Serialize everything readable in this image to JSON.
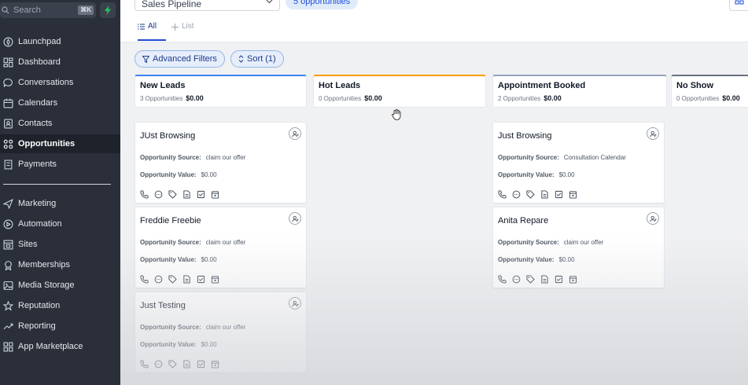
{
  "sidebar": {
    "search_label": "Search",
    "search_shortcut": "⌘K",
    "active_color": "#1e222b",
    "items": [
      {
        "label": "Launchpad",
        "icon": "rocket-icon"
      },
      {
        "label": "Dashboard",
        "icon": "dashboard-icon"
      },
      {
        "label": "Conversations",
        "icon": "chat-icon"
      },
      {
        "label": "Calendars",
        "icon": "calendar-icon"
      },
      {
        "label": "Contacts",
        "icon": "contacts-icon"
      },
      {
        "label": "Opportunities",
        "icon": "opportunities-icon",
        "active": true
      },
      {
        "label": "Payments",
        "icon": "payments-icon"
      },
      {
        "label": "Marketing",
        "icon": "send-icon"
      },
      {
        "label": "Automation",
        "icon": "automation-icon"
      },
      {
        "label": "Sites",
        "icon": "sites-icon"
      },
      {
        "label": "Memberships",
        "icon": "memberships-icon"
      },
      {
        "label": "Media Storage",
        "icon": "media-icon"
      },
      {
        "label": "Reputation",
        "icon": "star-icon"
      },
      {
        "label": "Reporting",
        "icon": "trend-icon"
      },
      {
        "label": "App Marketplace",
        "icon": "apps-icon"
      }
    ]
  },
  "header": {
    "pipeline": "Sales Pipeline",
    "opportunities_count": "5 opportunities",
    "tabs": [
      {
        "label": "All",
        "active": true
      },
      {
        "label": "List",
        "active": false
      }
    ],
    "filters": {
      "advanced": "Advanced Filters",
      "sort": "Sort (1)"
    }
  },
  "columns": [
    {
      "name": "New Leads",
      "count": "3 Opportunities",
      "value": "$0.00",
      "color": "#3b82f6"
    },
    {
      "name": "Hot Leads",
      "count": "0 Opportunities",
      "value": "$0.00",
      "color": "#f59e0b"
    },
    {
      "name": "Appointment Booked",
      "count": "2 Opportunities",
      "value": "$0.00",
      "color": "#94a3b8"
    },
    {
      "name": "No Show",
      "count": "0 Opportunities",
      "value": "$0.00",
      "color": "#6b7280"
    }
  ],
  "cards": [
    {
      "column": 0,
      "title": "JUst Browsing",
      "source_label": "Opportunity Source:",
      "source": "claim our offer",
      "value_label": "Opportunity Value:",
      "value": "$0.00"
    },
    {
      "column": 0,
      "title": "Freddie Freebie",
      "source_label": "Opportunity Source:",
      "source": "claim our offer",
      "value_label": "Opportunity Value:",
      "value": "$0.00"
    },
    {
      "column": 0,
      "title": "Just Testing",
      "source_label": "Opportunity Source:",
      "source": "claim our offer",
      "value_label": "Opportunity Value:",
      "value": "$0.00"
    },
    {
      "column": 2,
      "title": "Just Browsing",
      "source_label": "Opportunity Source:",
      "source": "Consultation Calendar",
      "value_label": "Opportunity Value:",
      "value": "$0.00"
    },
    {
      "column": 2,
      "title": "Anita Repare",
      "source_label": "Opportunity Source:",
      "source": "claim our offer",
      "value_label": "Opportunity Value:",
      "value": "$0.00"
    }
  ],
  "card_actions": [
    "phone-icon",
    "message-icon",
    "tag-icon",
    "note-icon",
    "task-icon",
    "appointment-icon"
  ]
}
